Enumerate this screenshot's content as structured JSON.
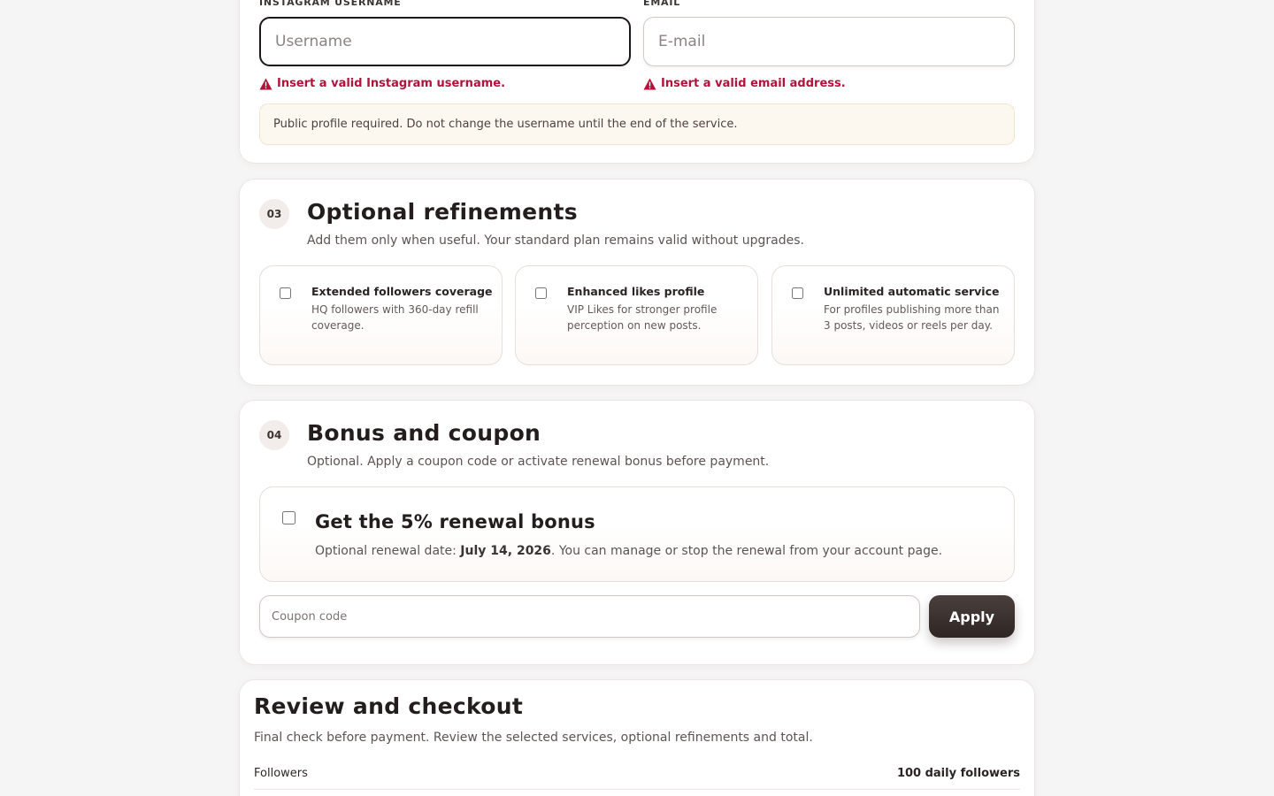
{
  "contact": {
    "username_label": "INSTAGRAM USERNAME",
    "username_placeholder": "Username",
    "username_value": "",
    "username_error": "Insert a valid Instagram username.",
    "email_label": "EMAIL",
    "email_placeholder": "E-mail",
    "email_value": "",
    "email_error": "Insert a valid email address.",
    "notice": "Public profile required. Do not change the username until the end of the service."
  },
  "refinements": {
    "step": "03",
    "title": "Optional refinements",
    "subtitle": "Add them only when useful. Your standard plan remains valid without upgrades.",
    "options": [
      {
        "title": "Extended followers coverage",
        "description": "HQ followers with 360-day refill coverage.",
        "checked": false
      },
      {
        "title": "Enhanced likes profile",
        "description": "VIP Likes for stronger profile perception on new posts.",
        "checked": false
      },
      {
        "title": "Unlimited automatic service",
        "description": "For profiles publishing more than 3 posts, videos or reels per day.",
        "checked": false
      }
    ]
  },
  "bonus": {
    "step": "04",
    "title": "Bonus and coupon",
    "subtitle": "Optional. Apply a coupon code or activate renewal bonus before payment.",
    "renewal_title": "Get the 5% renewal bonus",
    "renewal_prefix": "Optional renewal date: ",
    "renewal_date": "July 14, 2026",
    "renewal_suffix": ". You can manage or stop the renewal from your account page.",
    "renewal_checked": false,
    "coupon_placeholder": "Coupon code",
    "coupon_value": "",
    "apply_label": "Apply"
  },
  "review": {
    "title": "Review and checkout",
    "subtitle": "Final check before payment. Review the selected services, optional refinements and total.",
    "rows": [
      {
        "label": "Followers",
        "value": "100 daily followers"
      }
    ]
  },
  "colors": {
    "error": "#b3123a",
    "button": "#2e2624",
    "notice_bg": "#fdf8ef"
  },
  "icons": {
    "error_icon": "warning-triangle-icon"
  }
}
